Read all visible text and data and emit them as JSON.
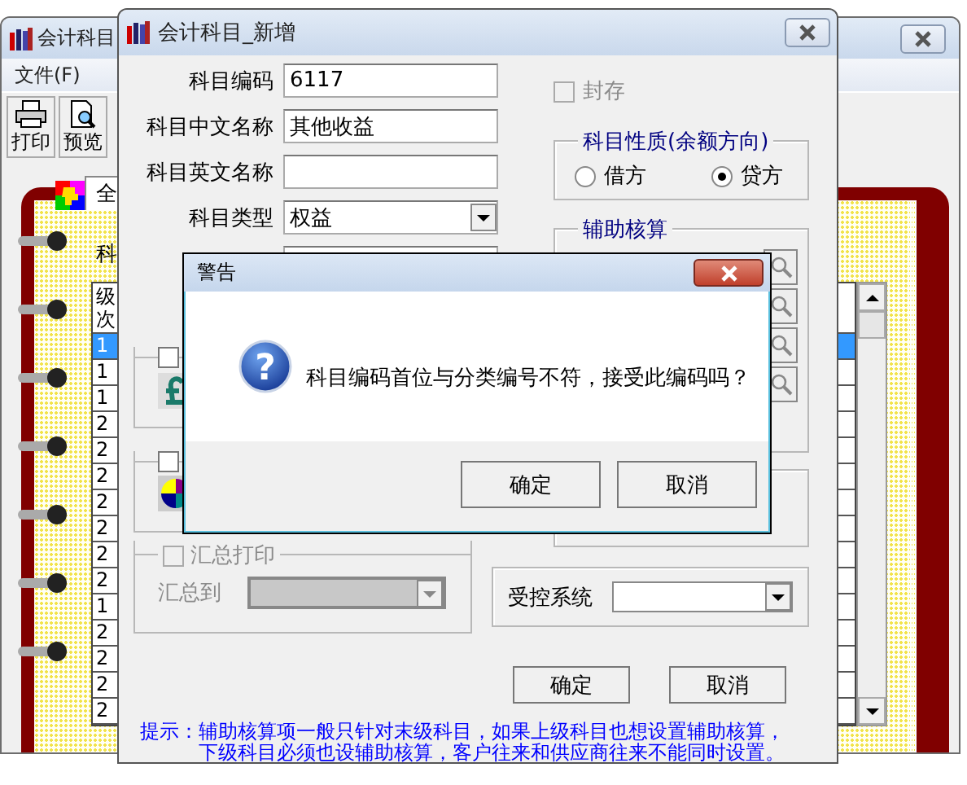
{
  "back_window": {
    "title": "会计科目",
    "menu": [
      "文件(F)"
    ],
    "toolbar": [
      {
        "label": "打印",
        "kind": "print"
      },
      {
        "label": "预览",
        "kind": "preview"
      }
    ],
    "tab": "全",
    "label": "科",
    "table": {
      "column": "级次",
      "rows": [
        {
          "level": "1",
          "selected": true
        },
        {
          "level": "1",
          "selected": false
        },
        {
          "level": "1",
          "selected": false
        },
        {
          "level": "2",
          "selected": false
        },
        {
          "level": "2",
          "selected": false
        },
        {
          "level": "2",
          "selected": false
        },
        {
          "level": "2",
          "selected": false
        },
        {
          "level": "2",
          "selected": false
        },
        {
          "level": "2",
          "selected": false
        },
        {
          "level": "2",
          "selected": false
        },
        {
          "level": "1",
          "selected": false
        },
        {
          "level": "2",
          "selected": false
        },
        {
          "level": "2",
          "selected": false
        },
        {
          "level": "2",
          "selected": false
        },
        {
          "level": "2",
          "selected": false
        }
      ]
    }
  },
  "dialog": {
    "title": "会计科目_新增",
    "fields": [
      {
        "label": "科目编码",
        "value": "6117",
        "kind": "text"
      },
      {
        "label": "科目中文名称",
        "value": "其他收益",
        "kind": "text"
      },
      {
        "label": "科目英文名称",
        "kind": "text"
      },
      {
        "label": "科目类型",
        "value": "权益",
        "kind": "combo"
      }
    ],
    "option_groups": [
      {
        "checked": false,
        "kind": "currency"
      },
      {
        "checked": false,
        "kind": "chart"
      }
    ],
    "summary_print": {
      "label": "汇总打印",
      "checked": false,
      "disabled": true,
      "target_label": "汇总到"
    },
    "archived": {
      "label": "封存",
      "checked": false,
      "disabled": true
    },
    "balance_direction": {
      "title": "科目性质(余额方向)",
      "options": [
        {
          "label": "借方",
          "selected": false
        },
        {
          "label": "贷方",
          "selected": true
        }
      ]
    },
    "auxiliary": {
      "title": "辅助核算"
    },
    "controlled_system": {
      "label": "受控系统"
    },
    "buttons": [
      "确定",
      "取消"
    ],
    "hint": "提示：辅助核算项一般只针对末级科目，如果上级科目也想设置辅助核算，下级科目必须也设辅助核算，客户往来和供应商往来不能同时设置。"
  },
  "alert": {
    "title": "警告",
    "icon_glyph": "?",
    "message": "科目编码首位与分类编号不符，接受此编码吗？",
    "buttons": [
      "确定",
      "取消"
    ]
  }
}
